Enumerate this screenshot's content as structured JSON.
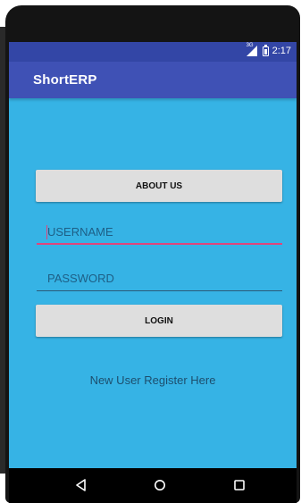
{
  "status_bar": {
    "network": "3G",
    "time": "2:17"
  },
  "app_bar": {
    "title": "ShortERP"
  },
  "main": {
    "about_button_label": "ABOUT US",
    "username_placeholder": "USERNAME",
    "password_placeholder": "PASSWORD",
    "login_button_label": "LOGIN",
    "register_link_text": "New User Register Here"
  },
  "nav_bar": {
    "icons": [
      "back-icon",
      "home-icon",
      "recents-icon"
    ]
  },
  "colors": {
    "status_bar": "#3346a6",
    "app_bar": "#3f51b5",
    "background": "#36b3e5",
    "button": "#dedede",
    "accent": "#e0457b"
  }
}
